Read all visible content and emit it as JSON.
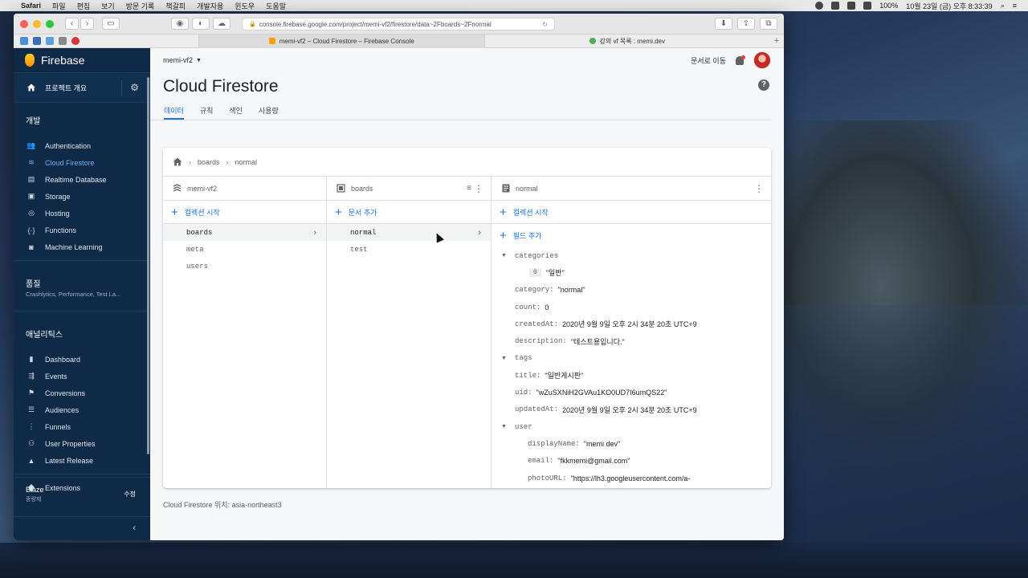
{
  "menubar": {
    "app_name": "Safari",
    "menus": [
      "파일",
      "편집",
      "보기",
      "방문 기록",
      "책갈피",
      "개발자용",
      "윈도우",
      "도움말"
    ],
    "battery": "100%",
    "clock": "10월 23일 (금) 오후 8:33:39"
  },
  "browser": {
    "url": "console.firebase.google.com/project/memi-vf2/firestore/data~2Fboards~2Fnormal",
    "tabs": [
      {
        "label": "memi-vf2 – Cloud Firestore – Firebase Console",
        "active": true
      },
      {
        "label": "강의 vf 목록 : memi.dev",
        "active": false
      }
    ],
    "new_tab": "+"
  },
  "sidebar": {
    "brand": "Firebase",
    "overview": "프로젝트 개요",
    "section_dev": "개발",
    "dev_items": [
      {
        "label": "Authentication",
        "icon": "users-icon"
      },
      {
        "label": "Cloud Firestore",
        "icon": "firestore-icon",
        "active": true
      },
      {
        "label": "Realtime Database",
        "icon": "database-icon"
      },
      {
        "label": "Storage",
        "icon": "storage-icon"
      },
      {
        "label": "Hosting",
        "icon": "hosting-icon"
      },
      {
        "label": "Functions",
        "icon": "functions-icon"
      },
      {
        "label": "Machine Learning",
        "icon": "robot-icon"
      }
    ],
    "section_quality": "품질",
    "quality_sub": "Crashlytics, Performance, Test La...",
    "section_analytics": "애널리틱스",
    "analytics_items": [
      {
        "label": "Dashboard",
        "icon": "chart-icon"
      },
      {
        "label": "Events",
        "icon": "events-icon"
      },
      {
        "label": "Conversions",
        "icon": "flag-icon"
      },
      {
        "label": "Audiences",
        "icon": "audience-icon"
      },
      {
        "label": "Funnels",
        "icon": "funnel-icon"
      },
      {
        "label": "User Properties",
        "icon": "properties-icon"
      },
      {
        "label": "Latest Release",
        "icon": "release-icon"
      }
    ],
    "extensions": "Extensions",
    "plan_name": "Blaze",
    "plan_desc": "종량제",
    "plan_edit": "수정",
    "collapse": "‹"
  },
  "topbar": {
    "project": "memi-vf2",
    "docs_link": "문서로 이동"
  },
  "page": {
    "title": "Cloud Firestore",
    "help": "?",
    "tabs": [
      "데이터",
      "규칙",
      "색인",
      "사용량"
    ],
    "active_tab": 0
  },
  "breadcrumb": [
    "boards",
    "normal"
  ],
  "columns": {
    "root": {
      "title": "memi-vf2",
      "add_label": "컬렉션 시작",
      "items": [
        "boards",
        "meta",
        "users"
      ],
      "selected": 0
    },
    "collection": {
      "title": "boards",
      "add_label": "문서 추가",
      "items": [
        "normal",
        "test"
      ],
      "selected": 0
    },
    "document": {
      "title": "normal",
      "add_collection_label": "컬렉션 시작",
      "add_field_label": "필드 추가",
      "fields": [
        {
          "key": "categories",
          "value": "",
          "type": "map",
          "expanded": true,
          "indent": 0
        },
        {
          "key": "",
          "index": "0",
          "value": "\"일반\"",
          "type": "array-item",
          "indent": 1
        },
        {
          "key": "category:",
          "value": "\"normal\"",
          "indent": 0
        },
        {
          "key": "count:",
          "value": "0",
          "indent": 0
        },
        {
          "key": "createdAt:",
          "value": "2020년 9월 9일 오후 2시 34분 20초 UTC+9",
          "indent": 0
        },
        {
          "key": "description:",
          "value": "\"테스트용입니다.\"",
          "indent": 0
        },
        {
          "key": "tags",
          "value": "",
          "type": "map",
          "expanded": true,
          "indent": 0
        },
        {
          "key": "title:",
          "value": "\"일반게시판\"",
          "indent": 0
        },
        {
          "key": "uid:",
          "value": "\"wZuSXNiH2GVAu1KO0UD7I6umQS22\"",
          "indent": 0
        },
        {
          "key": "updatedAt:",
          "value": "2020년 9월 9일 오후 2시 34분 20초 UTC+9",
          "indent": 0
        },
        {
          "key": "user",
          "value": "",
          "type": "map",
          "expanded": true,
          "indent": 0
        },
        {
          "key": "displayName:",
          "value": "\"memi dev\"",
          "indent": 1
        },
        {
          "key": "email:",
          "value": "\"fkkmemi@gmail.com\"",
          "indent": 1
        },
        {
          "key": "photoURL:",
          "value": "\"https://lh3.googleusercontent.com/a-",
          "indent": 1
        }
      ]
    }
  },
  "location": "Cloud Firestore 위치: asia-northeast3",
  "colors": {
    "sidebar_bg": "#0f2a46",
    "accent": "#1a73e8",
    "active_nav": "#64b5f6"
  }
}
